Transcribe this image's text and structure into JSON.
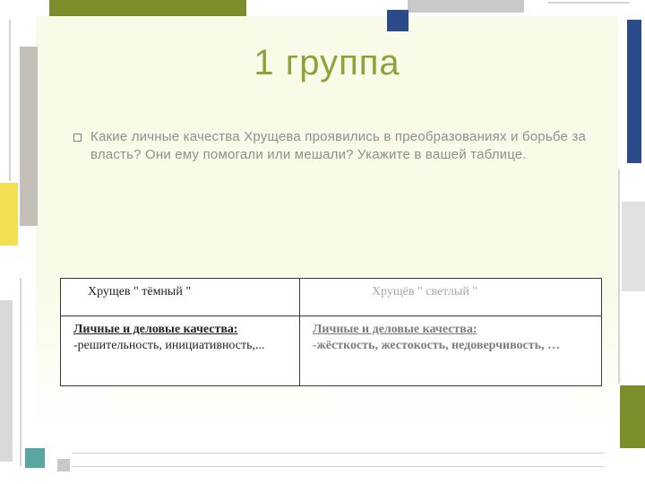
{
  "title": "1 группа",
  "bullet": "Какие личные качества Хрущева проявились в преобразованиях и борьбе за власть? Они ему помогали или мешали?  Укажите в вашей таблице.",
  "table": {
    "header_left": "Хрущев \" тёмный \"",
    "header_right": "Хрущёв \" светлый \"",
    "row_left_title": "Личные и деловые качества:",
    "row_left_body": "-решительность, инициативность,...",
    "row_right_title": "Личные и деловые качества:",
    "row_right_body": "-жёсткость, жестокость, недоверчивость, …"
  },
  "decor": {
    "olive": "#7a8f2b",
    "lightgrey": "#d9d9d9",
    "dimgrey": "#bfbfbf",
    "blue": "#2a4a8a",
    "yellow": "#f2df52",
    "teal": "#5aa6a0",
    "medgrey": "#bcbcbc"
  }
}
